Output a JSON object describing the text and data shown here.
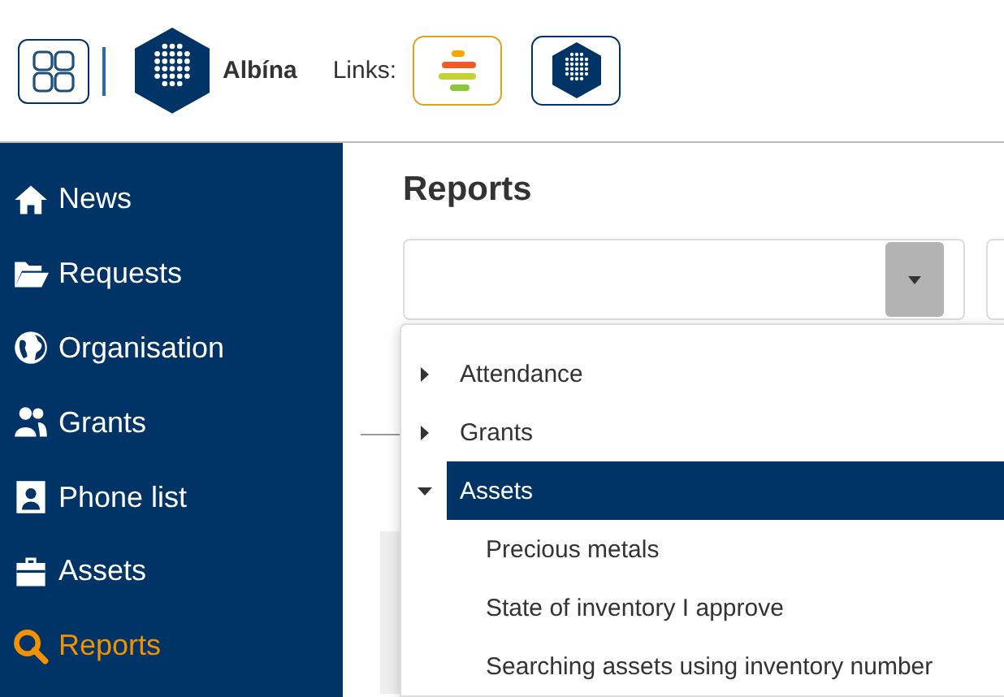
{
  "header": {
    "brand": "Albína",
    "links_label": "Links:"
  },
  "sidebar": {
    "items": [
      {
        "label": "News",
        "kind": "home",
        "selected": false
      },
      {
        "label": "Requests",
        "kind": "folder",
        "selected": false
      },
      {
        "label": "Organisation",
        "kind": "globe",
        "selected": false
      },
      {
        "label": "Grants",
        "kind": "users",
        "selected": false
      },
      {
        "label": "Phone list",
        "kind": "badge",
        "selected": false
      },
      {
        "label": "Assets",
        "kind": "case",
        "selected": false
      },
      {
        "label": "Reports",
        "kind": "search",
        "selected": true
      }
    ]
  },
  "main": {
    "title": "Reports",
    "report_tree": [
      {
        "label": "Attendance",
        "expanded": false,
        "selected": false
      },
      {
        "label": "Grants",
        "expanded": false,
        "selected": false
      },
      {
        "label": "Assets",
        "expanded": true,
        "selected": true,
        "children": [
          {
            "label": "Precious metals",
            "selected": false
          },
          {
            "label": "State of inventory I approve",
            "selected": false
          },
          {
            "label": "Searching assets using inventory number",
            "selected": false
          }
        ]
      }
    ]
  }
}
